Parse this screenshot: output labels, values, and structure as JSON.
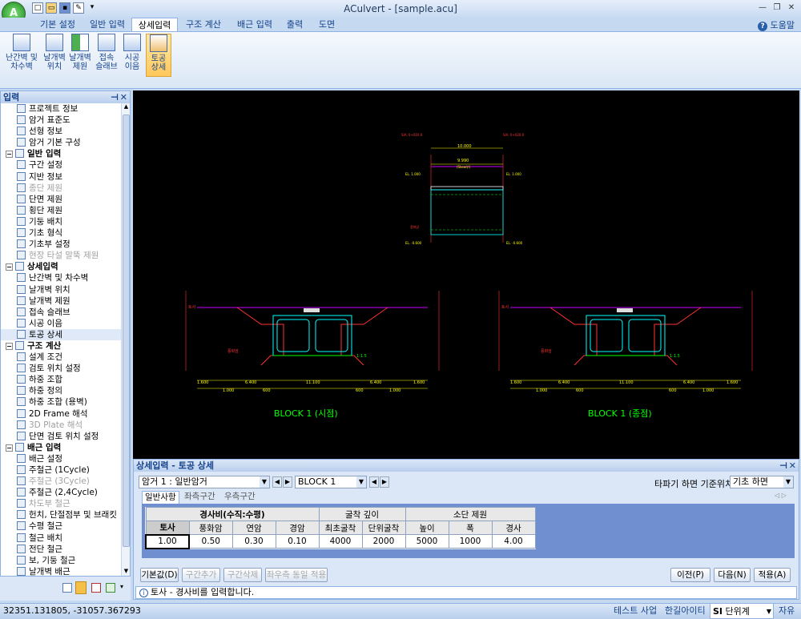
{
  "app": {
    "title": "ACulvert - [sample.acu]",
    "orb_label": "A"
  },
  "tabs": [
    "기본 설정",
    "일반 입력",
    "상세입력",
    "구조 계산",
    "배근 입력",
    "출력",
    "도면"
  ],
  "help_label": "도움말",
  "ribbon": [
    {
      "line1": "난간벽 및",
      "line2": "차수벽"
    },
    {
      "line1": "날개벽",
      "line2": "위치"
    },
    {
      "line1": "날개벽",
      "line2": "제원"
    },
    {
      "line1": "접속",
      "line2": "슬래브"
    },
    {
      "line1": "시공",
      "line2": "이음"
    },
    {
      "line1": "토공",
      "line2": "상세"
    }
  ],
  "left_panel": {
    "title": "입력",
    "items": [
      {
        "label": "프로젝트 정보",
        "type": "item"
      },
      {
        "label": "암거 표준도",
        "type": "item"
      },
      {
        "label": "선형 정보",
        "type": "item"
      },
      {
        "label": "암거 기본 구성",
        "type": "item"
      },
      {
        "label": "일반 입력",
        "type": "group"
      },
      {
        "label": "구간 설정",
        "type": "item"
      },
      {
        "label": "지반 정보",
        "type": "item"
      },
      {
        "label": "종단 제원",
        "type": "disabled"
      },
      {
        "label": "단면 제원",
        "type": "item"
      },
      {
        "label": "횡단 제원",
        "type": "item"
      },
      {
        "label": "기둥 배치",
        "type": "item"
      },
      {
        "label": "기초 형식",
        "type": "item"
      },
      {
        "label": "기초부 설정",
        "type": "item"
      },
      {
        "label": "현장 타설 말뚝 제원",
        "type": "disabled"
      },
      {
        "label": "상세입력",
        "type": "group"
      },
      {
        "label": "난간벽 및 차수벽",
        "type": "item"
      },
      {
        "label": "날개벽 위치",
        "type": "item"
      },
      {
        "label": "날개벽 제원",
        "type": "item"
      },
      {
        "label": "접속 슬래브",
        "type": "item"
      },
      {
        "label": "시공 이음",
        "type": "item"
      },
      {
        "label": "토공 상세",
        "type": "selected"
      },
      {
        "label": "구조 계산",
        "type": "group"
      },
      {
        "label": "설계 조건",
        "type": "item"
      },
      {
        "label": "검토 위치 설정",
        "type": "item"
      },
      {
        "label": "하중 조합",
        "type": "item"
      },
      {
        "label": "하중 정의",
        "type": "item"
      },
      {
        "label": "하중 조합 (용벽)",
        "type": "item"
      },
      {
        "label": "2D Frame 해석",
        "type": "item"
      },
      {
        "label": "3D Plate 해석",
        "type": "disabled"
      },
      {
        "label": "단면 검토 위치 설정",
        "type": "item"
      },
      {
        "label": "배근 입력",
        "type": "group"
      },
      {
        "label": "배근 설정",
        "type": "item"
      },
      {
        "label": "주철근 (1Cycle)",
        "type": "item"
      },
      {
        "label": "주철근 (3Cycle)",
        "type": "disabled"
      },
      {
        "label": "주철근 (2,4Cycle)",
        "type": "item"
      },
      {
        "label": "차도부 철근",
        "type": "disabled"
      },
      {
        "label": "헌치, 단절점부 및 브래킷",
        "type": "item"
      },
      {
        "label": "수평 철근",
        "type": "item"
      },
      {
        "label": "철근 배치",
        "type": "item"
      },
      {
        "label": "전단 철근",
        "type": "item"
      },
      {
        "label": "보, 기둥 철근",
        "type": "item"
      },
      {
        "label": "날개벽 배근",
        "type": "item"
      }
    ]
  },
  "drawing": {
    "block_left": "BLOCK 1 (시점)",
    "block_right": "BLOCK 1 (종점)",
    "top_dim_total": "10.000",
    "top_dim_inner": "9.990",
    "top_dim_inner_sub": "(Skew부)",
    "top_left_tag": "SIA. 0+010.0",
    "top_right_tag": "SIA. 0+020.0",
    "el_top": "EL. 1.000",
    "el_bottom": "EL. -0.600",
    "dim_left_top": "1.600",
    "dim_left_mid": "6.400",
    "dim_left_bot": "600",
    "dims_bottom": [
      "1.600",
      "6.400",
      "11.100",
      "6.400",
      "1.600"
    ],
    "dims_bottom2": [
      "1.000",
      "600",
      "600",
      "1.000"
    ],
    "label_tosa": "토사",
    "label_pungwha": "풍화암",
    "slope": "1:1.5"
  },
  "detail_panel": {
    "title": "상세입력 - 토공 상세",
    "culvert_select": "암거 1 : 일반암거",
    "block_select": "BLOCK  1",
    "ref_label": "타파기 하면 기준위치",
    "ref_select": "기초 하면",
    "subtabs": [
      "일반사항",
      "좌측구간",
      "우측구간"
    ],
    "group_headers": [
      "경사비(수직:수평)",
      "굴착 깊이",
      "소단 제원"
    ],
    "col_headers": [
      "토사",
      "풍화암",
      "연암",
      "경암",
      "최초굴착",
      "단위굴착",
      "높이",
      "폭",
      "경사"
    ],
    "values": [
      "1.00",
      "0.50",
      "0.30",
      "0.10",
      "4000",
      "2000",
      "5000",
      "1000",
      "4.00"
    ],
    "buttons_left": [
      "기본값(D)",
      "구간추가",
      "구간삭제",
      "좌우측 동일 적용"
    ],
    "buttons_right": [
      "이전(P)",
      "다음(N)",
      "적용(A)"
    ],
    "hint": "토사 - 경사비를 입력합니다."
  },
  "status": {
    "coords": "32351.131805,  -31057.367293",
    "project": "테스트 사업",
    "company": "한길아이티",
    "unit_prefix": "SI",
    "unit": "단위계",
    "mode": "자유"
  }
}
